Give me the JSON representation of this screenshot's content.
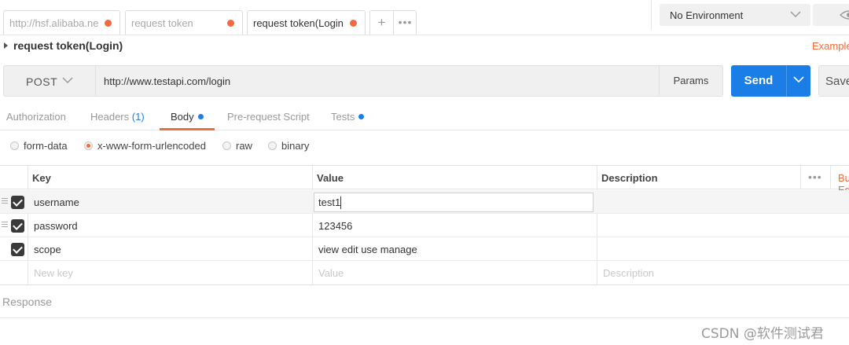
{
  "request_tabs": [
    {
      "label": "http://hsf.alibaba.ne",
      "active": false
    },
    {
      "label": "request token",
      "active": false
    },
    {
      "label": "request token(Login",
      "active": true
    }
  ],
  "new_tab": {
    "plus": "+",
    "more": "•••"
  },
  "environment": {
    "selected": "No Environment"
  },
  "request": {
    "title": "request token(Login)",
    "examples_label": "Examples",
    "method": "POST",
    "url": "http://www.testapi.com/login",
    "params_label": "Params",
    "send_label": "Send",
    "save_label": "Save"
  },
  "subtabs": {
    "authorization": "Authorization",
    "headers": "Headers",
    "headers_count": "(1)",
    "body": "Body",
    "prerequest": "Pre-request Script",
    "tests": "Tests",
    "active": "Body"
  },
  "body_types": {
    "form_data": "form-data",
    "urlencoded": "x-www-form-urlencoded",
    "raw": "raw",
    "binary": "binary",
    "selected": "x-www-form-urlencoded"
  },
  "table": {
    "headers": {
      "key": "Key",
      "value": "Value",
      "description": "Description",
      "more": "•••",
      "bulk": "Bulk Edit"
    },
    "rows": [
      {
        "key": "username",
        "value": "test1",
        "checked": true
      },
      {
        "key": "password",
        "value": "123456",
        "checked": true
      },
      {
        "key": "scope",
        "value": "view edit use manage",
        "checked": true
      }
    ],
    "new_row": {
      "key_placeholder": "New key",
      "value_placeholder": "Value",
      "description_placeholder": "Description"
    }
  },
  "response": {
    "label": "Response"
  },
  "watermark": "CSDN @软件测试君",
  "colors": {
    "accent": "#f26b3a",
    "primary": "#1a7ee6",
    "panel": "#f0f0f0"
  }
}
